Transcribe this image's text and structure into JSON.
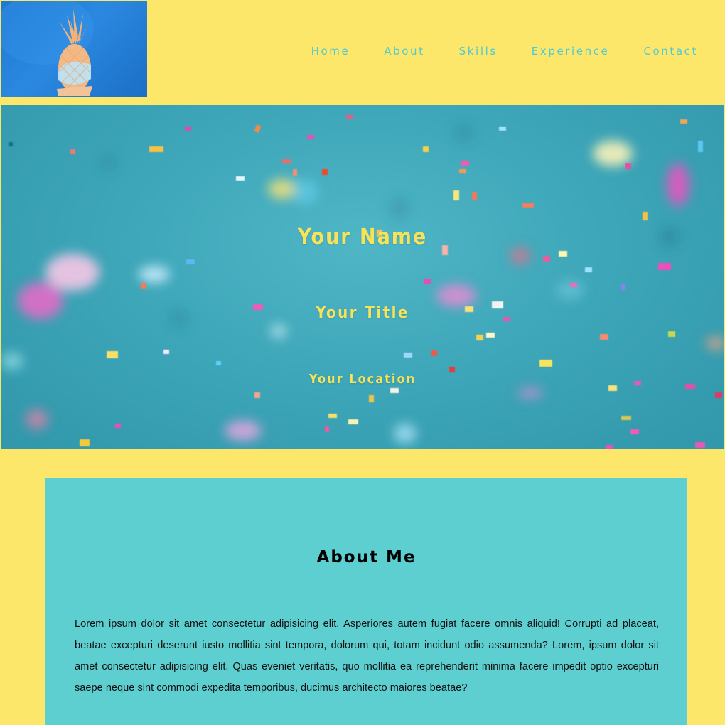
{
  "header": {
    "logo_alt": "pineapple-logo",
    "nav": [
      {
        "label": "Home"
      },
      {
        "label": "About"
      },
      {
        "label": "Skills"
      },
      {
        "label": "Experience"
      },
      {
        "label": "Contact"
      }
    ]
  },
  "hero": {
    "name": "Your Name",
    "title": "Your Title",
    "location": "Your Location"
  },
  "about": {
    "heading": "About Me",
    "body": "Lorem ipsum dolor sit amet consectetur adipisicing elit. Asperiores autem fugiat facere omnis aliquid! Corrupti ad placeat, beatae excepturi deserunt iusto mollitia sint tempora, dolorum qui, totam incidunt odio assumenda? Lorem, ipsum dolor sit amet consectetur adipisicing elit. Quas eveniet veritatis, quo mollitia ea reprehenderit minima facere impedit optio excepturi saepe neque sint commodi expedita temporibus, ducimus architecto maiores beatae?"
  },
  "colors": {
    "background": "#fde76b",
    "nav_text": "#4fc9d4",
    "hero_text": "#f6e35a",
    "about_panel": "#5ecfd0"
  }
}
